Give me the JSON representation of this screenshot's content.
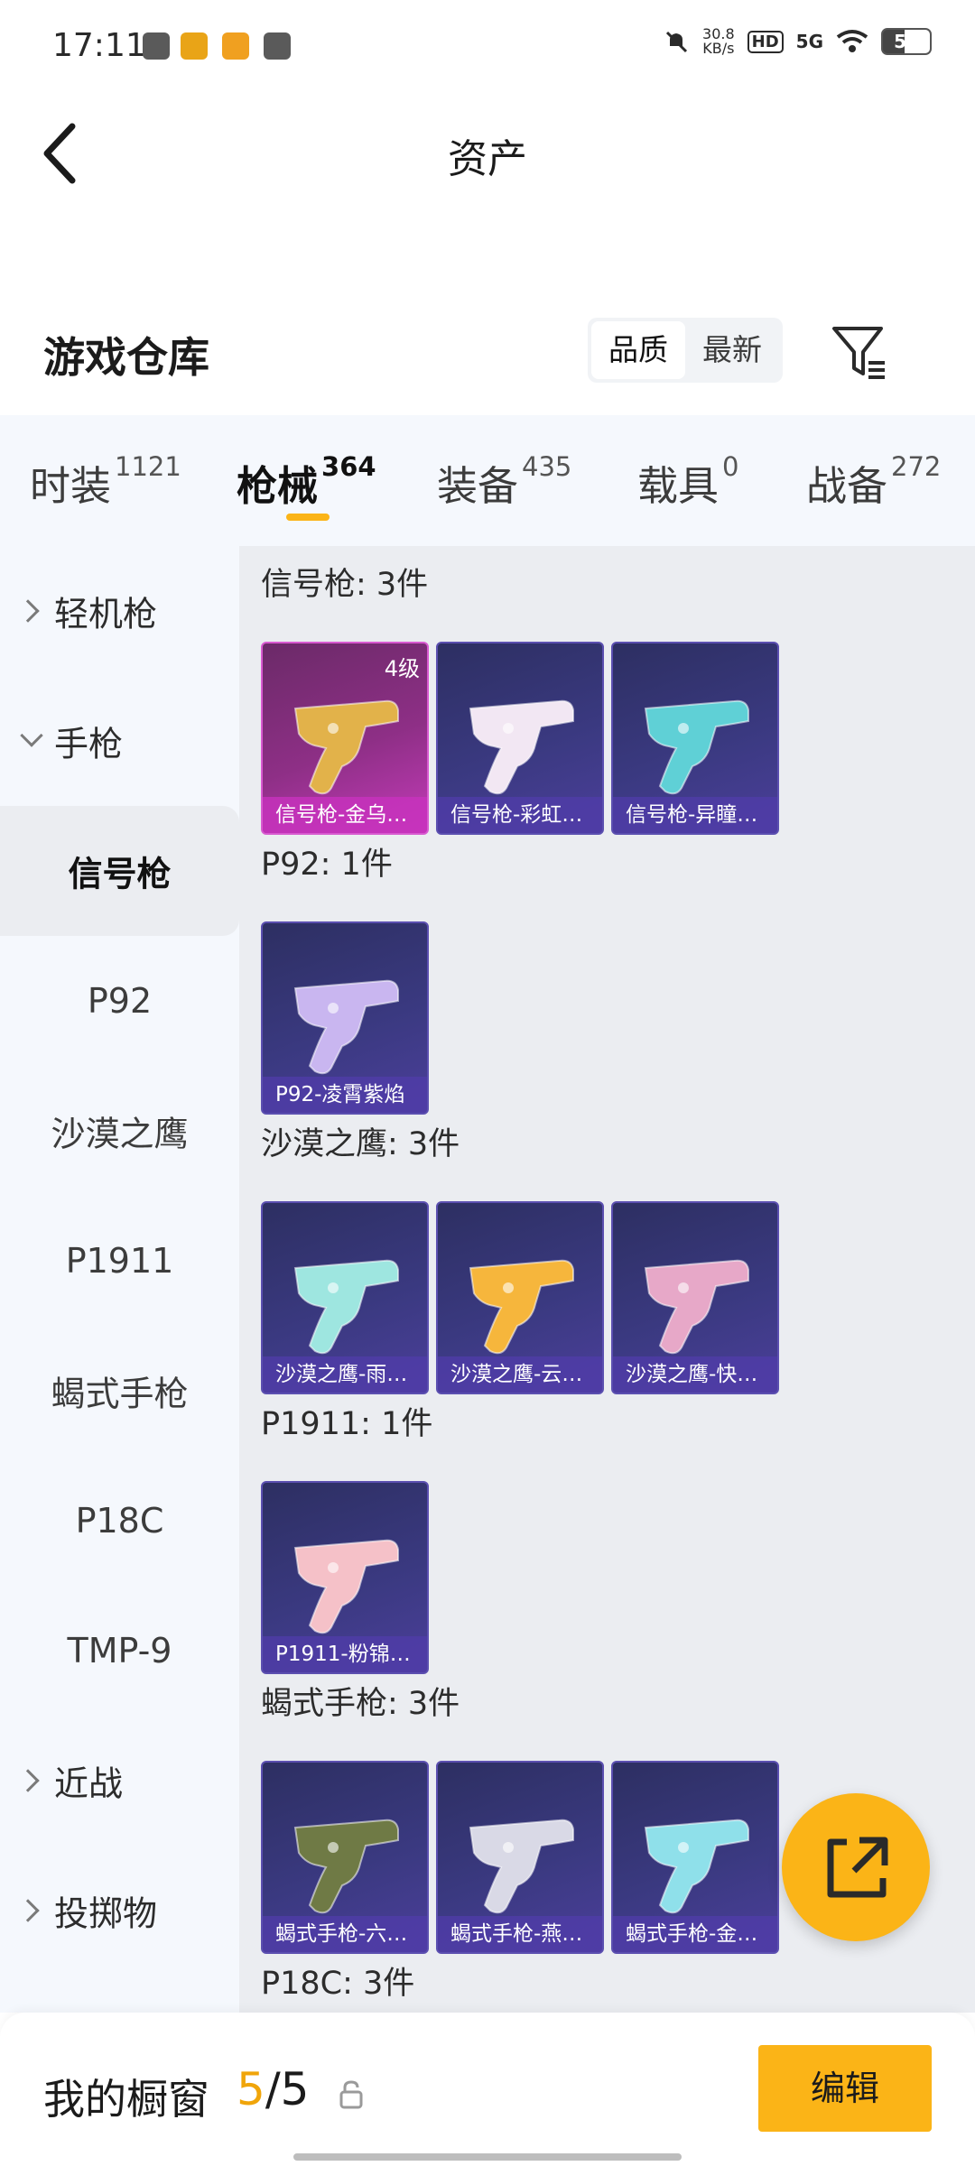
{
  "status_bar": {
    "time": "17:11",
    "net_speed": "30.8",
    "net_unit": "KB/s",
    "hd": "HD",
    "signal": "5G",
    "battery": "51"
  },
  "header": {
    "title": "资产"
  },
  "warehouse": {
    "title": "游戏仓库",
    "sort_options": [
      "品质",
      "最新"
    ],
    "selected_sort": "品质"
  },
  "tabs": [
    {
      "label": "时装",
      "count": "1121"
    },
    {
      "label": "枪械",
      "count": "364"
    },
    {
      "label": "装备",
      "count": "435"
    },
    {
      "label": "载具",
      "count": "0"
    },
    {
      "label": "战备",
      "count": "272"
    }
  ],
  "active_tab": "枪械",
  "sidebar": {
    "items": [
      {
        "label": "轻机枪",
        "type": "group",
        "expanded": false
      },
      {
        "label": "手枪",
        "type": "group",
        "expanded": true
      },
      {
        "label": "信号枪",
        "type": "sub",
        "selected": true
      },
      {
        "label": "P92",
        "type": "sub"
      },
      {
        "label": "沙漠之鹰",
        "type": "sub"
      },
      {
        "label": "P1911",
        "type": "sub"
      },
      {
        "label": "蝎式手枪",
        "type": "sub"
      },
      {
        "label": "P18C",
        "type": "sub"
      },
      {
        "label": "TMP-9",
        "type": "sub"
      },
      {
        "label": "近战",
        "type": "group",
        "expanded": false
      },
      {
        "label": "投掷物",
        "type": "group",
        "expanded": false
      }
    ]
  },
  "sections": [
    {
      "title": "信号枪: 3件",
      "items": [
        {
          "name": "信号枪-金乌…",
          "level": "4级",
          "rarity": "gold",
          "color": "#e2b24a"
        },
        {
          "name": "信号枪-彩虹…",
          "rarity": "purple",
          "color": "#f2e7f3"
        },
        {
          "name": "信号枪-异瞳…",
          "rarity": "purple",
          "color": "#5fd0d6"
        }
      ]
    },
    {
      "title": "P92: 1件",
      "items": [
        {
          "name": "P92-凌霄紫焰",
          "rarity": "purple",
          "color": "#c9b6f0"
        }
      ]
    },
    {
      "title": "沙漠之鹰: 3件",
      "items": [
        {
          "name": "沙漠之鹰-雨…",
          "rarity": "purple",
          "color": "#9ee6e0"
        },
        {
          "name": "沙漠之鹰-云…",
          "rarity": "purple",
          "color": "#f6b63c"
        },
        {
          "name": "沙漠之鹰-快…",
          "rarity": "purple",
          "color": "#e7a8c8"
        }
      ]
    },
    {
      "title": "P1911: 1件",
      "items": [
        {
          "name": "P1911-粉锦…",
          "rarity": "purple",
          "color": "#f5c1c8"
        }
      ]
    },
    {
      "title": "蝎式手枪: 3件",
      "items": [
        {
          "name": "蝎式手枪-六…",
          "rarity": "purple",
          "color": "#6f7a45"
        },
        {
          "name": "蝎式手枪-燕…",
          "rarity": "purple",
          "color": "#d9d9e6"
        },
        {
          "name": "蝎式手枪-金…",
          "rarity": "purple",
          "color": "#8fe0ea"
        }
      ]
    },
    {
      "title": "P18C: 3件",
      "items": []
    }
  ],
  "bottom_bar": {
    "title": "我的橱窗",
    "current": "5",
    "total": "/5",
    "edit_label": "编辑"
  },
  "colors": {
    "accent": "#fbb417",
    "sidebar_bg": "#f5f8fd",
    "content_bg": "#ebedf1",
    "card_purple": "#3a3980",
    "card_gold": "#c33bb8"
  }
}
